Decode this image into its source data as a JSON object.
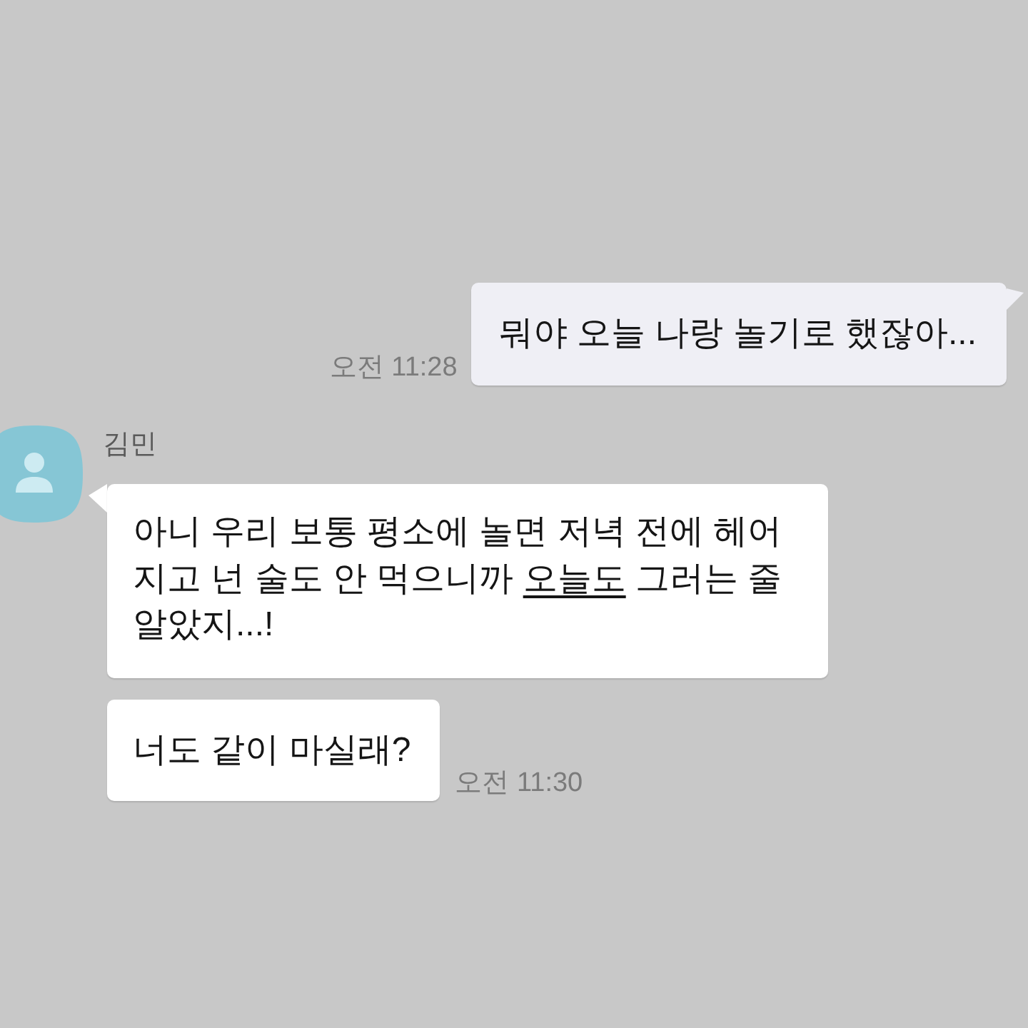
{
  "messages": [
    {
      "kind": "sent",
      "bubbles": [
        {
          "segments": [
            {
              "text": "뭐야 오늘 나랑 놀기로 했잖아...",
              "underline": false
            }
          ]
        }
      ],
      "time": "오전 11:28"
    },
    {
      "kind": "received",
      "sender": {
        "name": "김민"
      },
      "bubbles": [
        {
          "segments": [
            {
              "text": "아니 우리 보통 평소에 놀면 저녁 전에 헤어지고 넌 술도 안 먹으니까 ",
              "underline": false
            },
            {
              "text": "오늘도",
              "underline": true
            },
            {
              "text": " 그러는 줄 알았지...!",
              "underline": false
            }
          ]
        },
        {
          "segments": [
            {
              "text": "너도 같이 마실래?",
              "underline": false
            }
          ]
        }
      ],
      "time": "오전 11:30"
    }
  ]
}
